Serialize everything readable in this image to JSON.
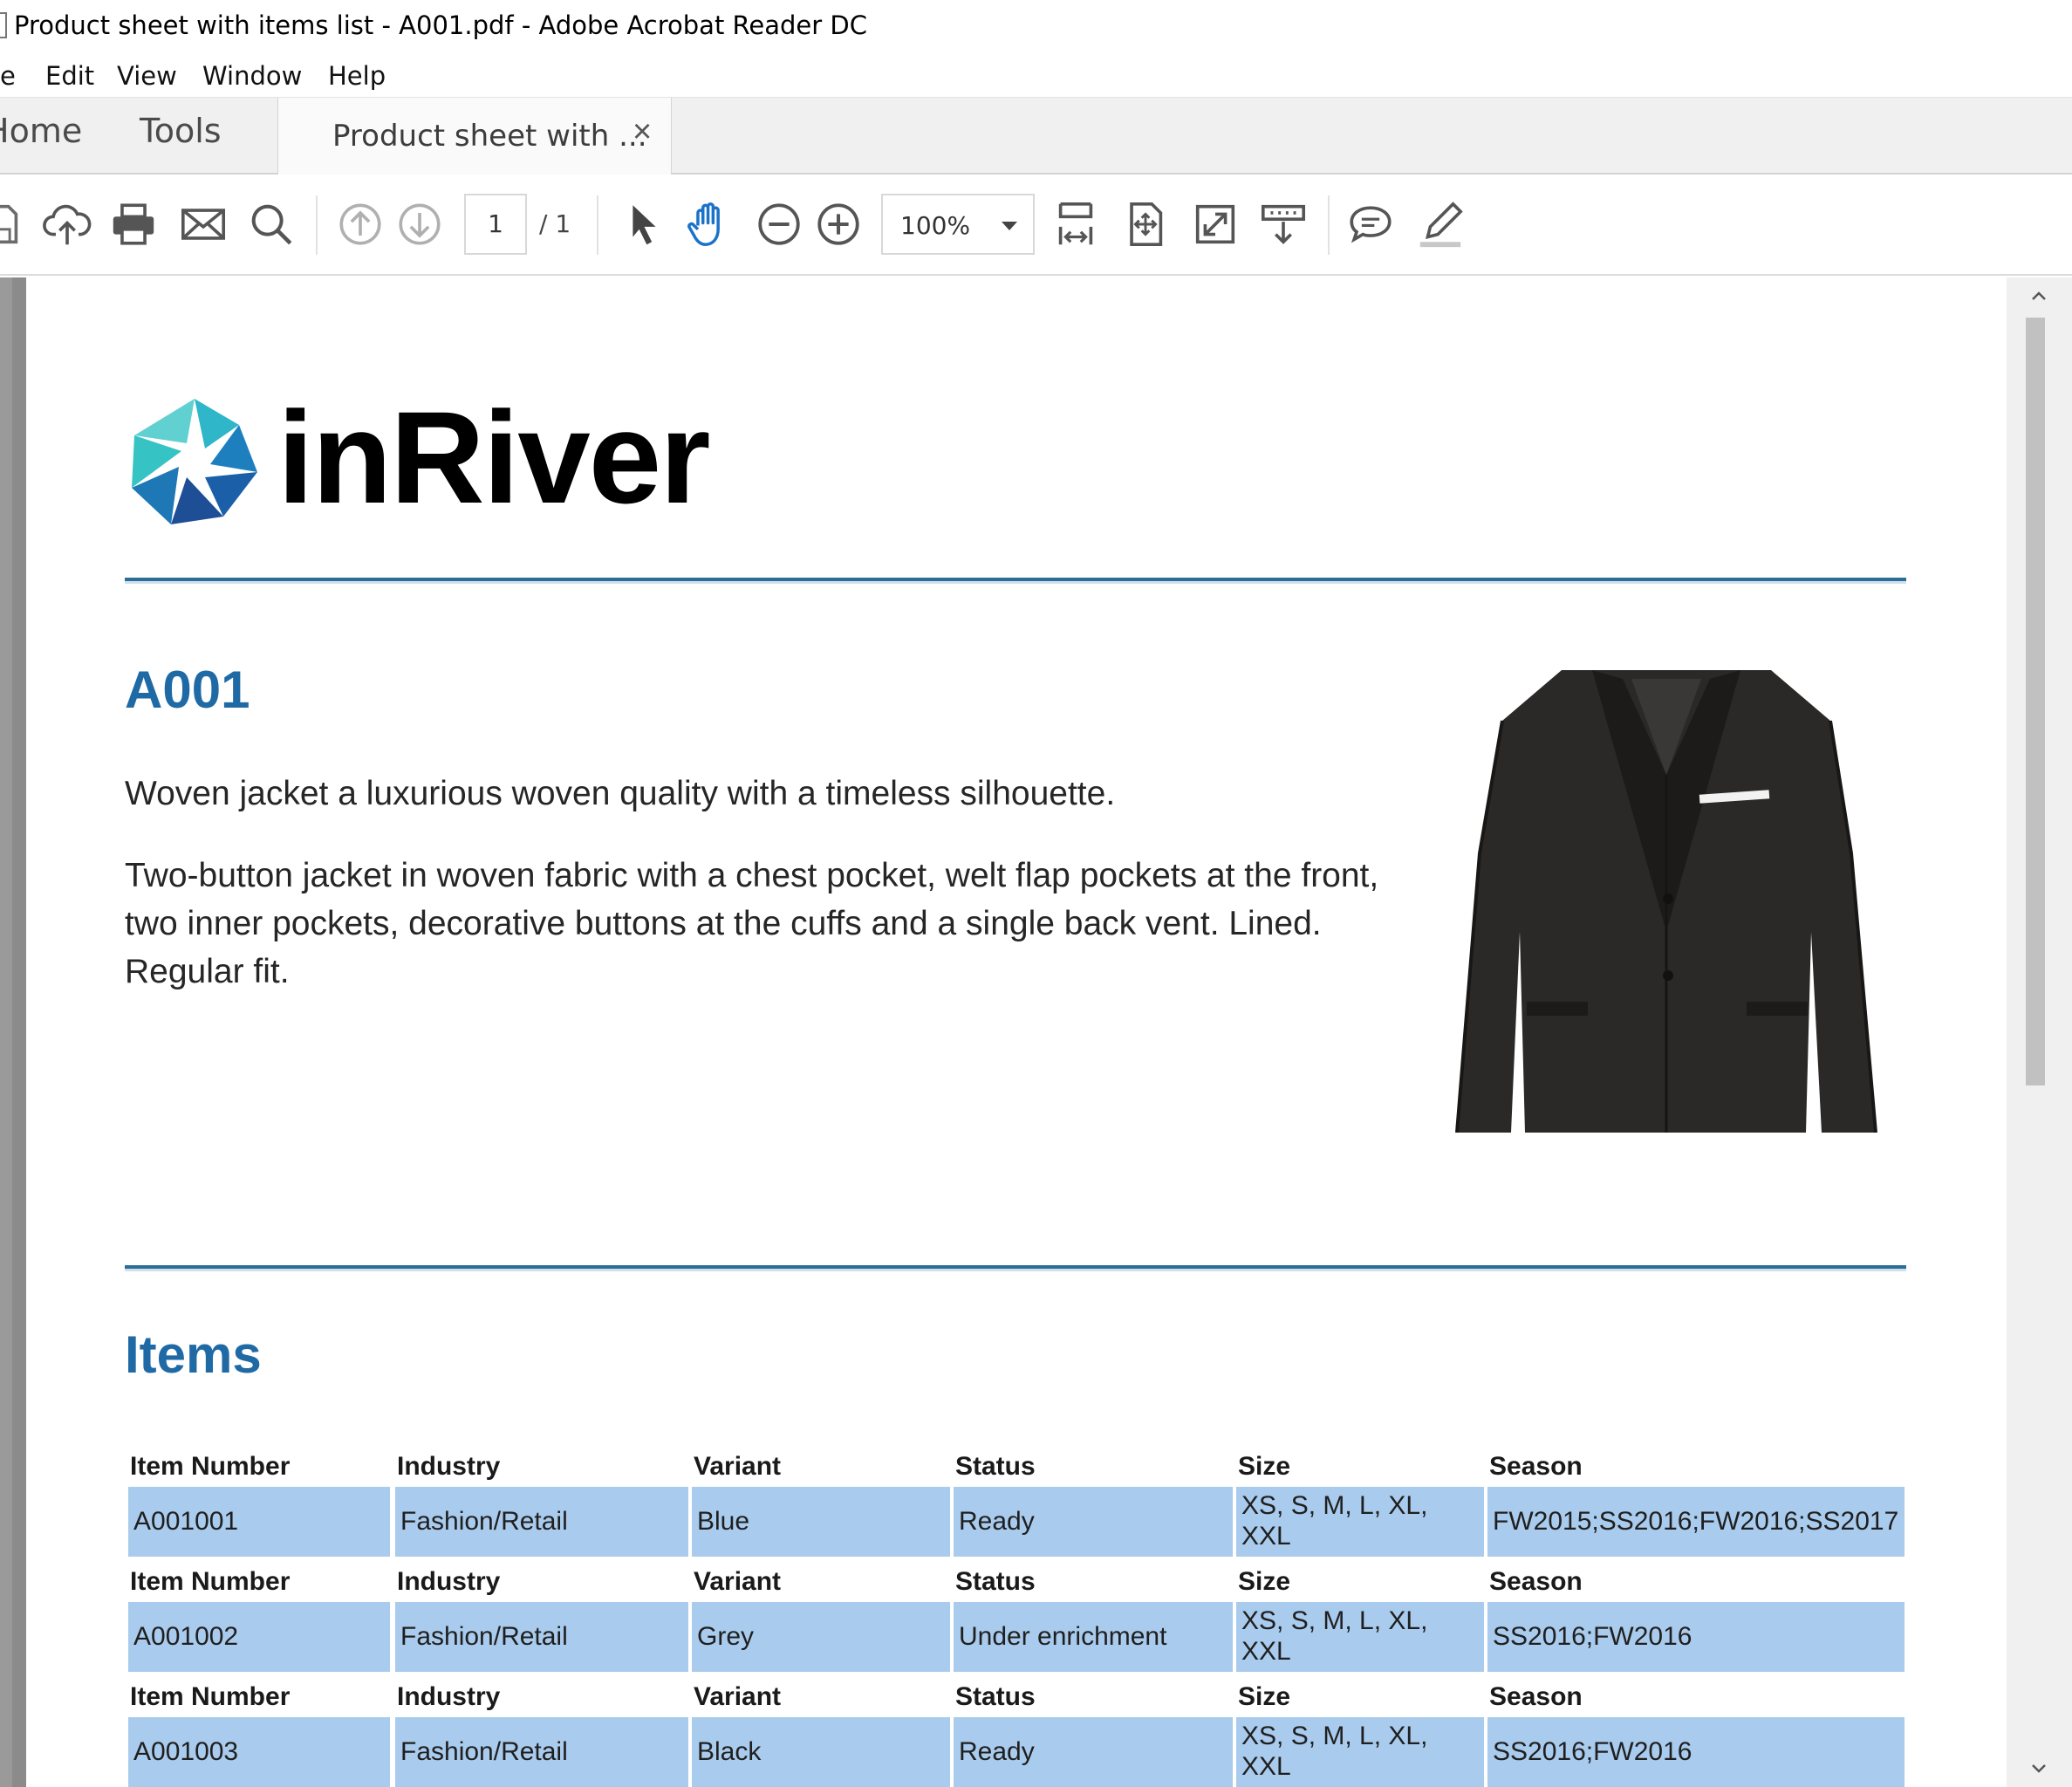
{
  "window": {
    "title": "Product sheet with items list - A001.pdf - Adobe Acrobat Reader DC"
  },
  "menu": [
    "e",
    "Edit",
    "View",
    "Window",
    "Help"
  ],
  "tabs": {
    "home": "Home",
    "tools": "Tools",
    "document": "Product sheet with ...",
    "close_glyph": "×"
  },
  "toolbar": {
    "page_current": "1",
    "page_total": "/  1",
    "zoom": "100%",
    "hand_tool_color": "#1a73c9"
  },
  "document": {
    "brand": "inRiver",
    "product_id": "A001",
    "description_short": "Woven jacket a luxurious woven quality with a timeless silhouette.",
    "description_long": "Two-button jacket in woven fabric with a chest pocket, welt flap pockets at the front, two inner pockets, decorative buttons at the cuffs and a single back vent. Lined. Regular fit.",
    "items_heading": "Items",
    "accent_color": "#1f6aa5",
    "row_color": "#a9cbed",
    "columns": [
      "Item Number",
      "Industry",
      "Variant",
      "Status",
      "Size",
      "Season"
    ],
    "items": [
      {
        "item_number": "A001001",
        "industry": "Fashion/Retail",
        "variant": "Blue",
        "status": "Ready",
        "size": "XS, S, M, L, XL, XXL",
        "season": "FW2015;SS2016;FW2016;SS2017"
      },
      {
        "item_number": "A001002",
        "industry": "Fashion/Retail",
        "variant": "Grey",
        "status": "Under enrichment",
        "size": "XS, S, M, L, XL, XXL",
        "season": "SS2016;FW2016"
      },
      {
        "item_number": "A001003",
        "industry": "Fashion/Retail",
        "variant": "Black",
        "status": "Ready",
        "size": "XS, S, M, L, XL, XXL",
        "season": "SS2016;FW2016"
      }
    ]
  }
}
